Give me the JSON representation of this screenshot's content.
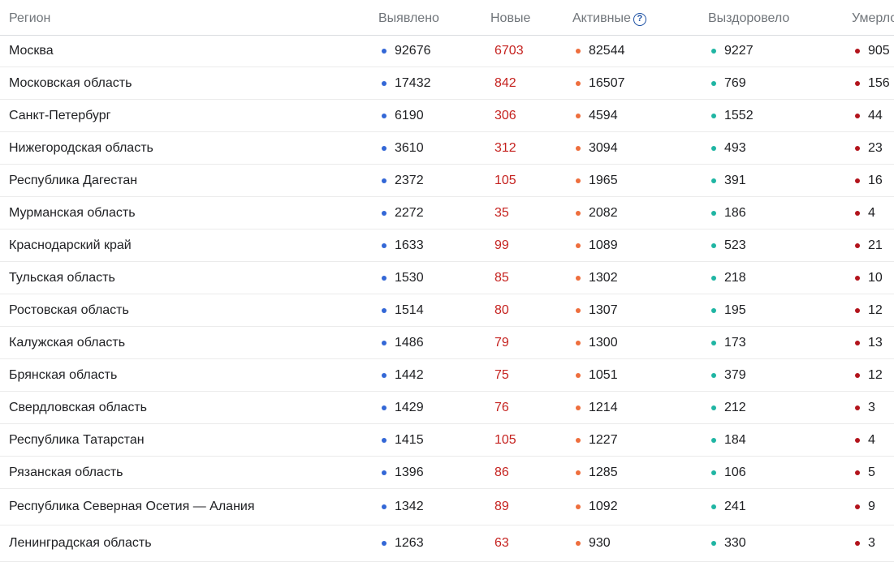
{
  "header": {
    "region": "Регион",
    "confirmed": "Выявлено",
    "new": "Новые",
    "active": "Активные",
    "recovered": "Выздоровело",
    "deaths": "Умерло",
    "help_glyph": "?"
  },
  "colors": {
    "confirmed_dot": "#3367d6",
    "new_text": "#c5221f",
    "active_dot": "#ee6e3d",
    "recovered_dot": "#1fb5a3",
    "deaths_dot": "#b3141c"
  },
  "rows": [
    {
      "region": "Москва",
      "confirmed": "92676",
      "new": "6703",
      "active": "82544",
      "recovered": "9227",
      "deaths": "905"
    },
    {
      "region": "Московская область",
      "confirmed": "17432",
      "new": "842",
      "active": "16507",
      "recovered": "769",
      "deaths": "156"
    },
    {
      "region": "Санкт-Петербург",
      "confirmed": "6190",
      "new": "306",
      "active": "4594",
      "recovered": "1552",
      "deaths": "44"
    },
    {
      "region": "Нижегородская область",
      "confirmed": "3610",
      "new": "312",
      "active": "3094",
      "recovered": "493",
      "deaths": "23"
    },
    {
      "region": "Республика Дагестан",
      "confirmed": "2372",
      "new": "105",
      "active": "1965",
      "recovered": "391",
      "deaths": "16"
    },
    {
      "region": "Мурманская область",
      "confirmed": "2272",
      "new": "35",
      "active": "2082",
      "recovered": "186",
      "deaths": "4"
    },
    {
      "region": "Краснодарский край",
      "confirmed": "1633",
      "new": "99",
      "active": "1089",
      "recovered": "523",
      "deaths": "21"
    },
    {
      "region": "Тульская область",
      "confirmed": "1530",
      "new": "85",
      "active": "1302",
      "recovered": "218",
      "deaths": "10"
    },
    {
      "region": "Ростовская область",
      "confirmed": "1514",
      "new": "80",
      "active": "1307",
      "recovered": "195",
      "deaths": "12"
    },
    {
      "region": "Калужская область",
      "confirmed": "1486",
      "new": "79",
      "active": "1300",
      "recovered": "173",
      "deaths": "13"
    },
    {
      "region": "Брянская область",
      "confirmed": "1442",
      "new": "75",
      "active": "1051",
      "recovered": "379",
      "deaths": "12"
    },
    {
      "region": "Свердловская область",
      "confirmed": "1429",
      "new": "76",
      "active": "1214",
      "recovered": "212",
      "deaths": "3"
    },
    {
      "region": "Республика Татарстан",
      "confirmed": "1415",
      "new": "105",
      "active": "1227",
      "recovered": "184",
      "deaths": "4"
    },
    {
      "region": "Рязанская область",
      "confirmed": "1396",
      "new": "86",
      "active": "1285",
      "recovered": "106",
      "deaths": "5"
    },
    {
      "region": "Республика Северная Осетия — Алания",
      "confirmed": "1342",
      "new": "89",
      "active": "1092",
      "recovered": "241",
      "deaths": "9"
    },
    {
      "region": "Ленинградская область",
      "confirmed": "1263",
      "new": "63",
      "active": "930",
      "recovered": "330",
      "deaths": "3"
    }
  ]
}
